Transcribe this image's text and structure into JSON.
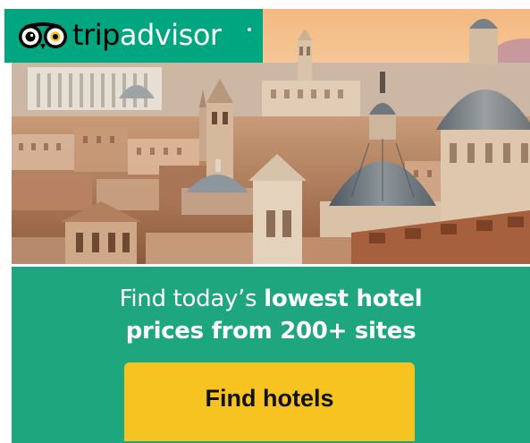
{
  "brand": {
    "name_part1": "trip",
    "name_part2": "advisor",
    "owl_icon": "tripadvisor-owl-eyes-icon"
  },
  "banner_image": {
    "subject": "city-skyline-with-domes-photo"
  },
  "headline": {
    "line1_regular": "Find today’s ",
    "line1_bold": "lowest hotel",
    "line2_bold": "prices from 200+ sites"
  },
  "cta": {
    "label": "Find hotels"
  },
  "colors": {
    "brand_green": "#00a680",
    "panel_green": "#1ea67e",
    "button_yellow": "#f6c320",
    "text_white": "#ffffff"
  }
}
